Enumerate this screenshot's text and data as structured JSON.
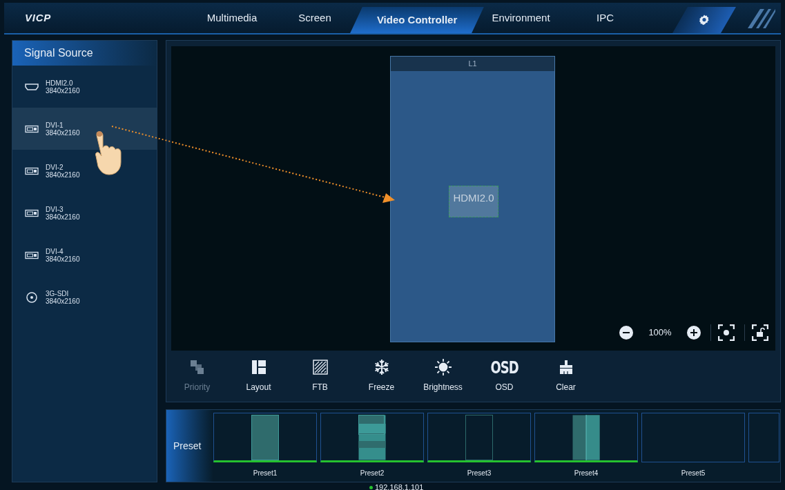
{
  "header": {
    "logo": "VICP",
    "tabs": [
      {
        "label": "Multimedia",
        "selected": false
      },
      {
        "label": "Screen",
        "selected": false
      },
      {
        "label": "Video Controller",
        "selected": true
      },
      {
        "label": "Environment",
        "selected": false
      },
      {
        "label": "IPC",
        "selected": false
      }
    ]
  },
  "sidebar": {
    "title": "Signal Source",
    "items": [
      {
        "kind": "hdmi",
        "name": "HDMI2.0",
        "resolution": "3840x2160",
        "selected": false
      },
      {
        "kind": "dvi",
        "name": "DVI-1",
        "resolution": "3840x2160",
        "selected": true
      },
      {
        "kind": "dvi",
        "name": "DVI-2",
        "resolution": "3840x2160",
        "selected": false
      },
      {
        "kind": "dvi",
        "name": "DVI-3",
        "resolution": "3840x2160",
        "selected": false
      },
      {
        "kind": "dvi",
        "name": "DVI-4",
        "resolution": "3840x2160",
        "selected": false
      },
      {
        "kind": "sdi",
        "name": "3G-SDI",
        "resolution": "3840x2160",
        "selected": false
      }
    ]
  },
  "canvas": {
    "screen": {
      "layer": "L1",
      "window": "HDMI2.0"
    },
    "zoom": "100%"
  },
  "toolbar": [
    {
      "kind": "priority",
      "label": "Priority",
      "disabled": true
    },
    {
      "kind": "layout",
      "label": "Layout",
      "disabled": false
    },
    {
      "kind": "ftb",
      "label": "FTB",
      "disabled": false
    },
    {
      "kind": "freeze",
      "label": "Freeze",
      "disabled": false
    },
    {
      "kind": "brightness",
      "label": "Brightness",
      "disabled": false
    },
    {
      "kind": "osd",
      "label": "OSD",
      "icon_text": "OSD",
      "disabled": false
    },
    {
      "kind": "clear",
      "label": "Clear",
      "disabled": false
    }
  ],
  "presets": {
    "title": "Preset",
    "items": [
      {
        "kind": "single",
        "label": "Preset1",
        "saved": true
      },
      {
        "kind": "stacked",
        "label": "Preset2",
        "saved": true
      },
      {
        "kind": "outline",
        "label": "Preset3",
        "saved": true
      },
      {
        "kind": "split",
        "label": "Preset4",
        "saved": true
      },
      {
        "kind": "empty",
        "label": "Preset5",
        "saved": false
      }
    ]
  },
  "status": {
    "ip": "192.168.1.101"
  }
}
